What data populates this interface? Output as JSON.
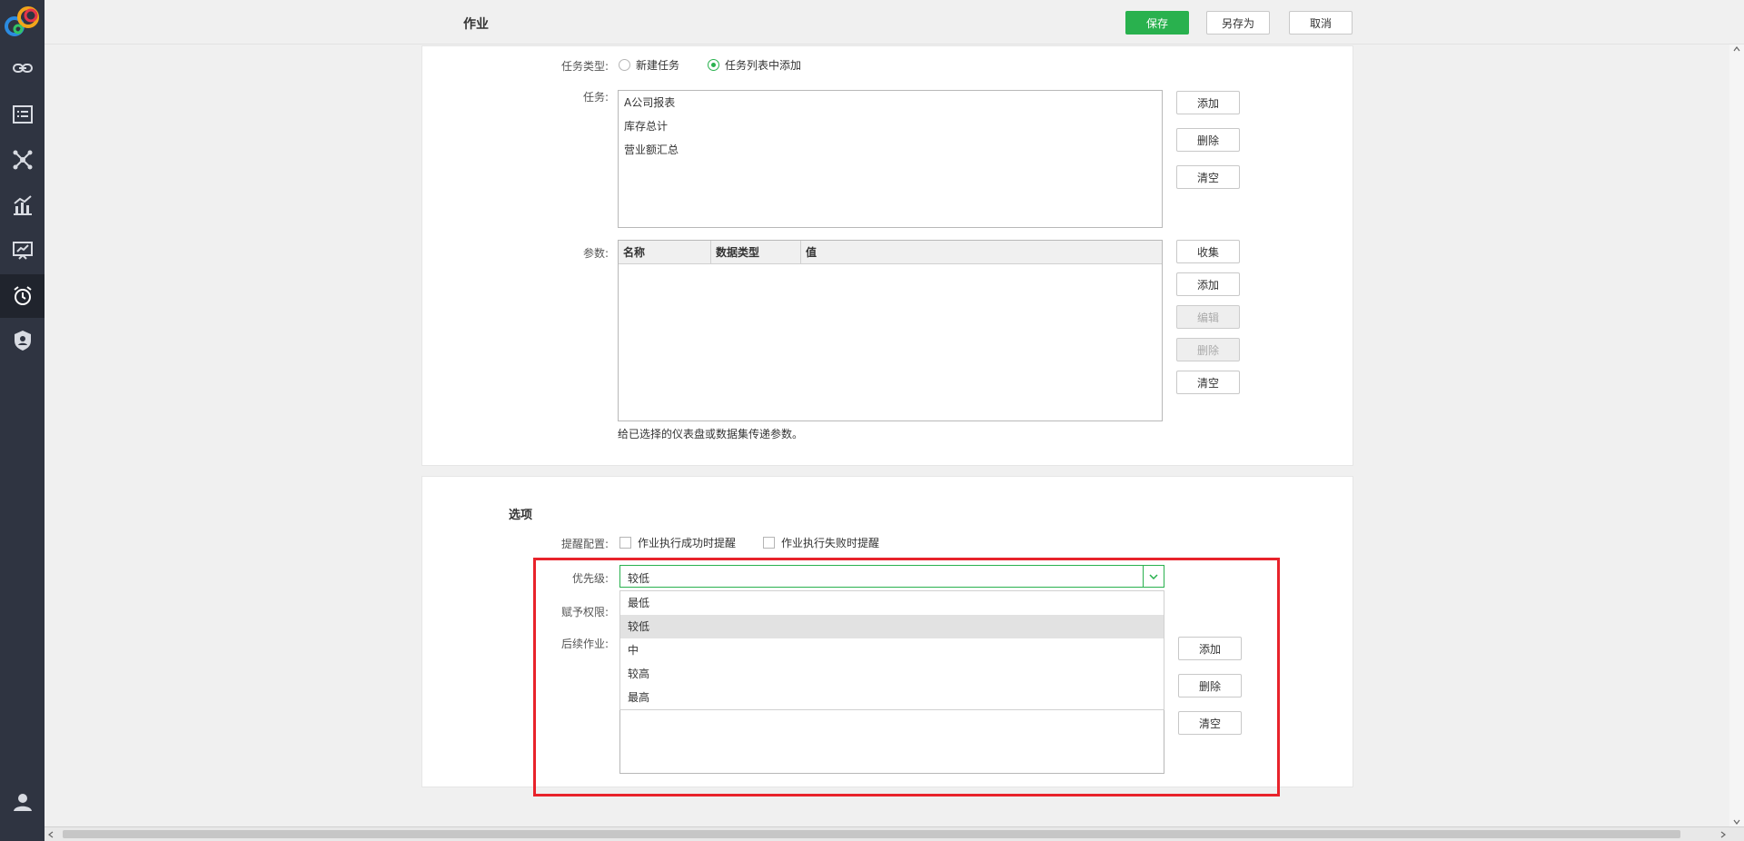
{
  "header": {
    "title": "作业",
    "save_label": "保存",
    "save_as_label": "另存为",
    "cancel_label": "取消"
  },
  "task_type": {
    "label": "任务类型:",
    "option_new": "新建任务",
    "option_from_list": "任务列表中添加",
    "selected": "任务列表中添加"
  },
  "tasks": {
    "label": "任务:",
    "items": [
      "A公司报表",
      "库存总计",
      "营业额汇总"
    ],
    "add": "添加",
    "delete": "删除",
    "clear": "清空"
  },
  "params": {
    "label": "参数:",
    "columns": [
      "名称",
      "数据类型",
      "值"
    ],
    "collect": "收集",
    "add": "添加",
    "edit": "编辑",
    "delete": "删除",
    "clear": "清空",
    "hint": "给已选择的仪表盘或数据集传递参数。"
  },
  "options": {
    "section_title": "选项",
    "reminder_label": "提醒配置:",
    "reminder_success": "作业执行成功时提醒",
    "reminder_fail": "作业执行失败时提醒",
    "priority_label": "优先级:",
    "priority_value": "较低",
    "priority_options": [
      "最低",
      "较低",
      "中",
      "较高",
      "最高"
    ],
    "permission_label": "赋予权限:",
    "followup_label": "后续作业:",
    "add": "添加",
    "delete": "删除",
    "clear": "清空"
  },
  "colors": {
    "accent": "#29b14e",
    "sidebar": "#2f3441",
    "highlight": "#e8232b"
  }
}
